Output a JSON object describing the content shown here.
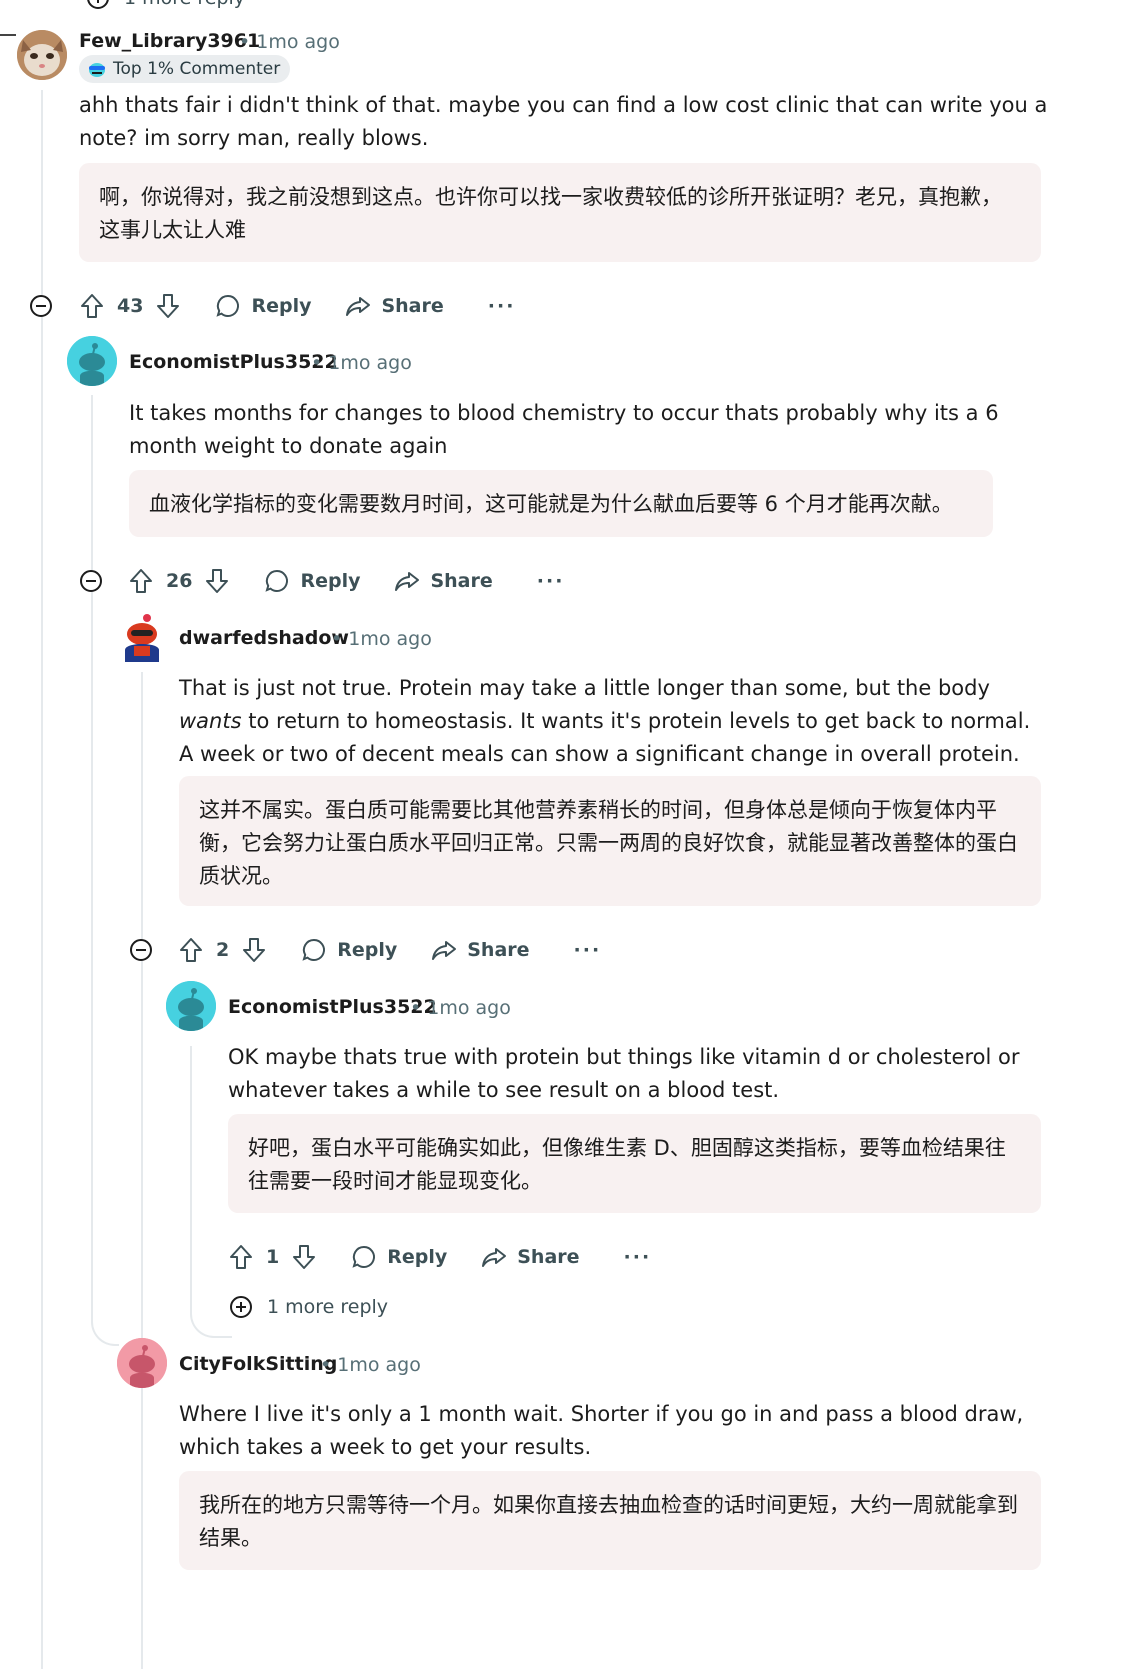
{
  "top": {
    "more_reply": "1 more reply"
  },
  "comments": [
    {
      "username": "Few_Library3961",
      "time": "• 1mo ago",
      "flair": "Top 1% Commenter",
      "body": "ahh thats fair i didn't think of that. maybe you can find a low cost clinic that can write you a note? im sorry man, really blows.",
      "translation": "啊，你说得对，我之前没想到这点。也许你可以找一家收费较低的诊所开张证明？老兄，真抱歉，这事儿太让人难",
      "votes": "43",
      "reply": "Reply",
      "share": "Share",
      "more": "···"
    },
    {
      "username": "EconomistPlus3522",
      "time": "• 1mo ago",
      "body": "It takes months for changes to blood chemistry to occur thats probably why its a 6 month weight to donate again",
      "translation": "血液化学指标的变化需要数月时间，这可能就是为什么献血后要等 6 个月才能再次献。",
      "votes": "26",
      "reply": "Reply",
      "share": "Share",
      "more": "···"
    },
    {
      "username": "dwarfedshadow",
      "time": "• 1mo ago",
      "body_pre": "That is just not true. Protein may take a little longer than some, but the body ",
      "body_em": "wants",
      "body_post": " to return to homeostasis. It wants it's protein levels to get back to normal. A week or two of decent meals can show a significant change in overall protein.",
      "translation": "这并不属实。蛋白质可能需要比其他营养素稍长的时间，但身体总是倾向于恢复体内平衡，它会努力让蛋白质水平回归正常。只需一两周的良好饮食，就能显著改善整体的蛋白质状况。",
      "votes": "2",
      "reply": "Reply",
      "share": "Share",
      "more": "···"
    },
    {
      "username": "EconomistPlus3522",
      "time": "• 1mo ago",
      "body": "OK maybe thats true with protein but things like vitamin d or cholesterol or whatever takes a while to see result on a blood test.",
      "translation": "好吧，蛋白水平可能确实如此，但像维生素 D、胆固醇这类指标，要等血检结果往往需要一段时间才能显现变化。",
      "votes": "1",
      "reply": "Reply",
      "share": "Share",
      "more": "···",
      "more_reply": "1 more reply"
    },
    {
      "username": "CityFolkSitting",
      "time": "• 1mo ago",
      "body": "Where I live it's only a 1 month wait. Shorter if you go in and pass a blood draw, which takes a week to get your results.",
      "translation": "我所在的地方只需等待一个月。如果你直接去抽血检查的话时间更短，大约一周就能拿到结果。"
    }
  ],
  "colors": {
    "thread": "#e5e9ec",
    "translation_bg": "#f8f1f1",
    "meta": "#576f76",
    "snoo_teal": "#46d1e0",
    "snoo_pink": "#f29aa6"
  }
}
